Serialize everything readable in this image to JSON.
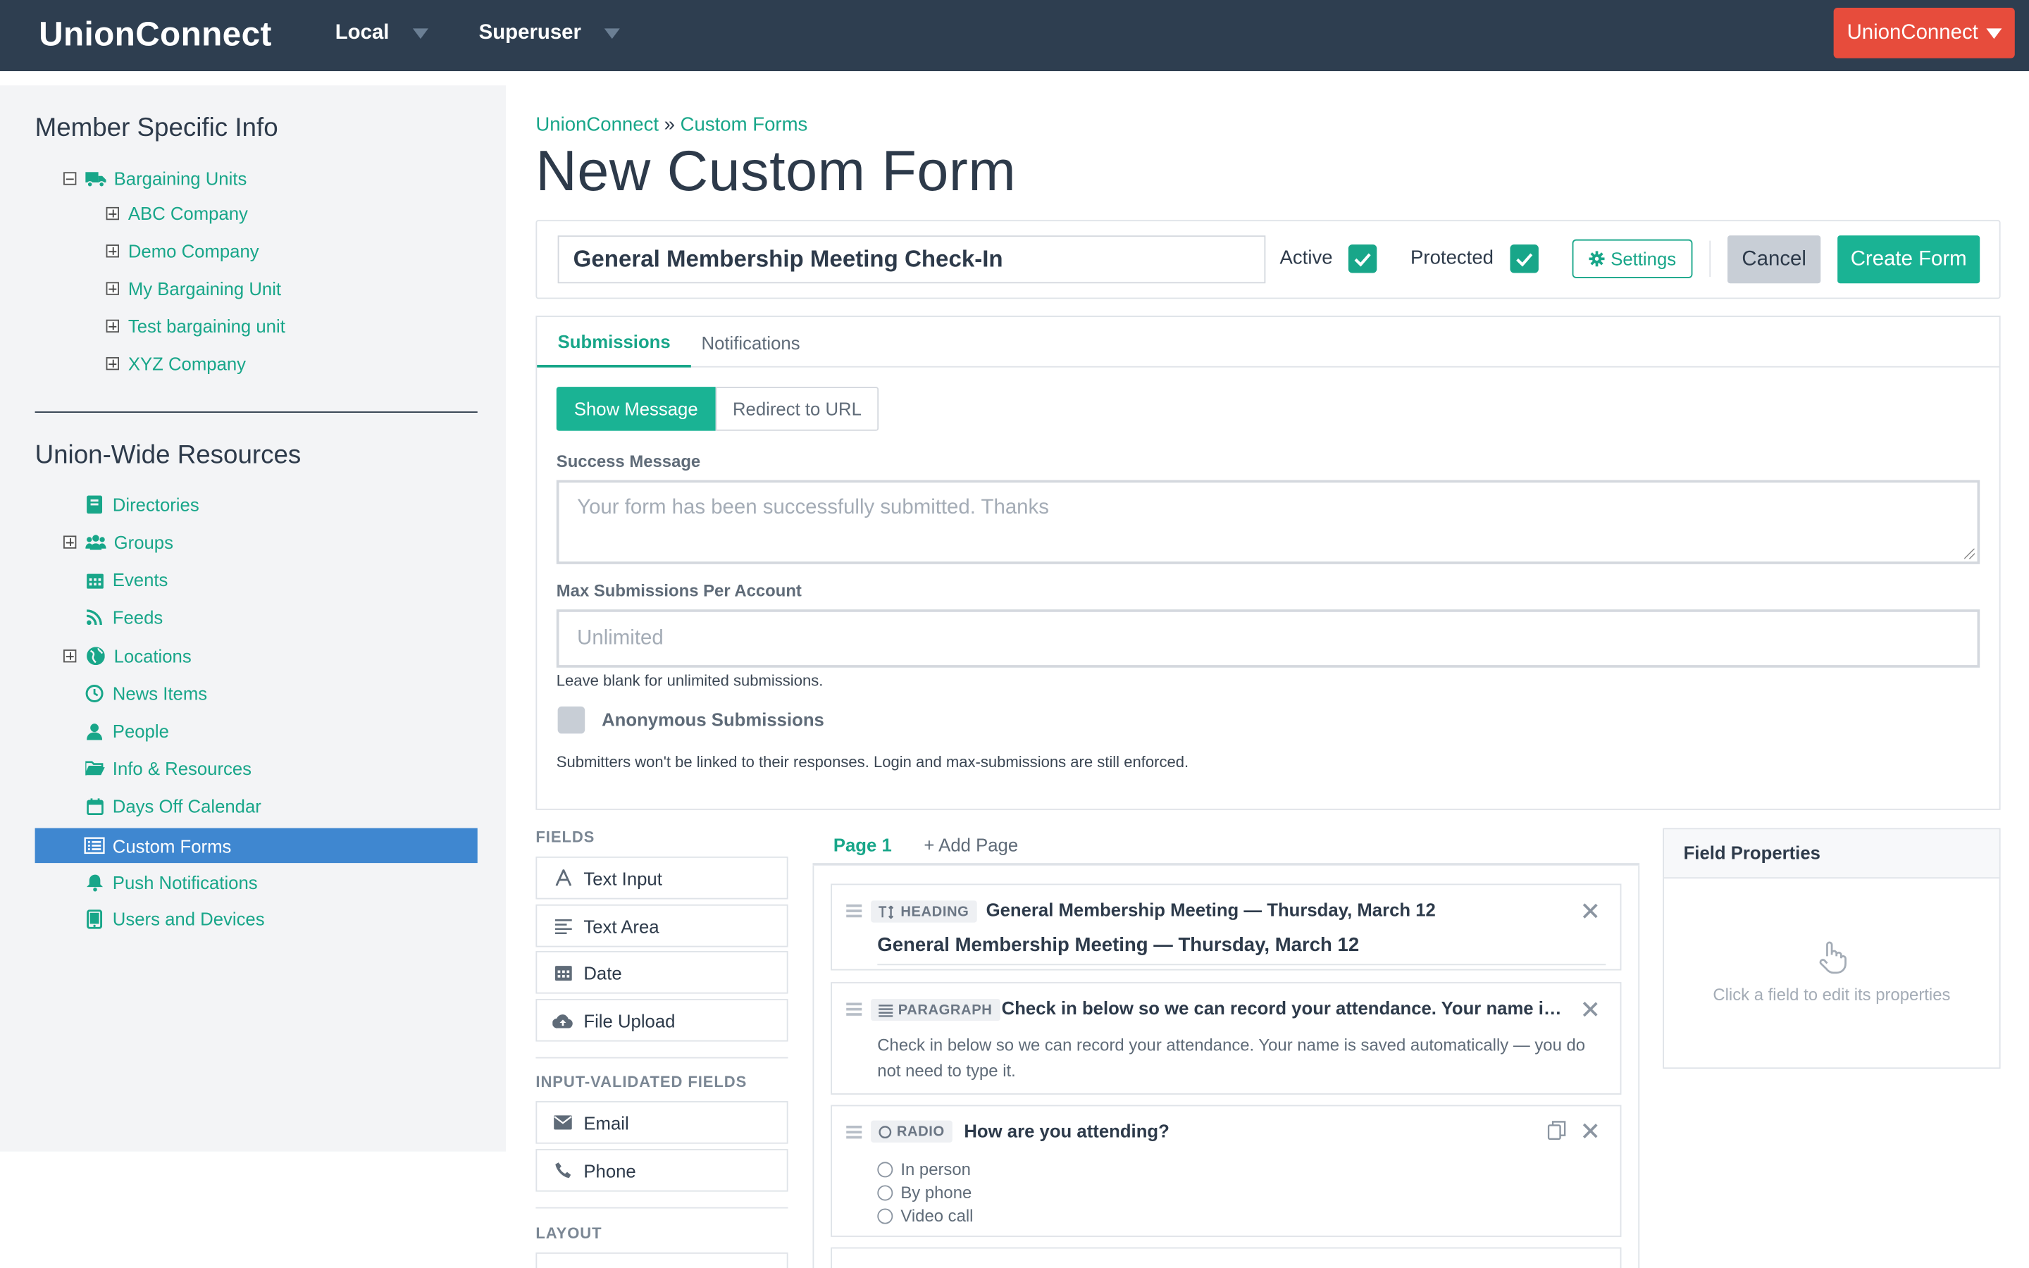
{
  "navbar": {
    "brand": "UnionConnect",
    "menu_local": "Local",
    "menu_superuser": "Superuser",
    "account_button": "UnionConnect",
    "bg_color": "#2e3e50",
    "account_color": "#e74c3c"
  },
  "sidebar": {
    "member_heading": "Member Specific Info",
    "bargaining_root": "Bargaining Units",
    "bargaining_children": [
      "ABC Company",
      "Demo Company",
      "My Bargaining Unit",
      "Test bargaining unit",
      "XYZ Company"
    ],
    "union_heading": "Union-Wide Resources",
    "items": [
      {
        "label": "Directories",
        "icon": "book-icon"
      },
      {
        "label": "Groups",
        "icon": "users-icon"
      },
      {
        "label": "Events",
        "icon": "calendar-grid-icon"
      },
      {
        "label": "Feeds",
        "icon": "rss-icon"
      },
      {
        "label": "Locations",
        "icon": "globe-icon"
      },
      {
        "label": "News Items",
        "icon": "clock-icon"
      },
      {
        "label": "People",
        "icon": "person-icon"
      },
      {
        "label": "Info & Resources",
        "icon": "folder-open-icon"
      },
      {
        "label": "Days Off Calendar",
        "icon": "calendar-icon"
      },
      {
        "label": "Custom Forms",
        "icon": "list-alt-icon",
        "active": true
      },
      {
        "label": "Push Notifications",
        "icon": "bell-icon"
      },
      {
        "label": "Users and Devices",
        "icon": "tablet-icon"
      }
    ],
    "accent_color": "#18a689",
    "active_color": "#3f87d0"
  },
  "breadcrumb": {
    "root": "UnionConnect",
    "sep": "»",
    "current": "Custom Forms"
  },
  "page_title": "New Custom Form",
  "form_bar": {
    "name_value": "General Membership Meeting Check-In",
    "active_label": "Active",
    "active_checked": true,
    "protected_label": "Protected",
    "protected_checked": true,
    "settings_label": "Settings",
    "cancel_label": "Cancel",
    "create_label": "Create Form"
  },
  "tabs": {
    "submissions": "Submissions",
    "notifications": "Notifications"
  },
  "submissions": {
    "show_message": "Show Message",
    "redirect_url": "Redirect to URL",
    "success_label": "Success Message",
    "success_placeholder": "Your form has been successfully submitted. Thanks",
    "max_label": "Max Submissions Per Account",
    "max_placeholder": "Unlimited",
    "max_help": "Leave blank for unlimited submissions.",
    "anon_label": "Anonymous Submissions",
    "anon_checked": false,
    "anon_help": "Submitters won't be linked to their responses. Login and max-submissions are still enforced."
  },
  "palette": {
    "fields_title": "FIELDS",
    "fields": [
      "Text Input",
      "Text Area",
      "Date",
      "File Upload"
    ],
    "validated_title": "INPUT-VALIDATED FIELDS",
    "validated": [
      "Email",
      "Phone"
    ],
    "layout_title": "LAYOUT"
  },
  "canvas": {
    "page1": "Page 1",
    "add_page": "+ Add Page",
    "heading_badge": "HEADING",
    "heading_title": "General Membership Meeting — Thursday, March 12",
    "heading_preview": "General Membership Meeting — Thursday, March 12",
    "paragraph_badge": "PARAGRAPH",
    "paragraph_title": "Check in below so we can record your attendance. Your name is s...",
    "paragraph_body": "Check in below so we can record your attendance. Your name is saved automatically — you do not need to type it.",
    "radio_badge": "RADIO",
    "radio_title": "How are you attending?",
    "radio_options": [
      "In person",
      "By phone",
      "Video call"
    ]
  },
  "properties": {
    "title": "Field Properties",
    "hint": "Click a field to edit its properties"
  }
}
